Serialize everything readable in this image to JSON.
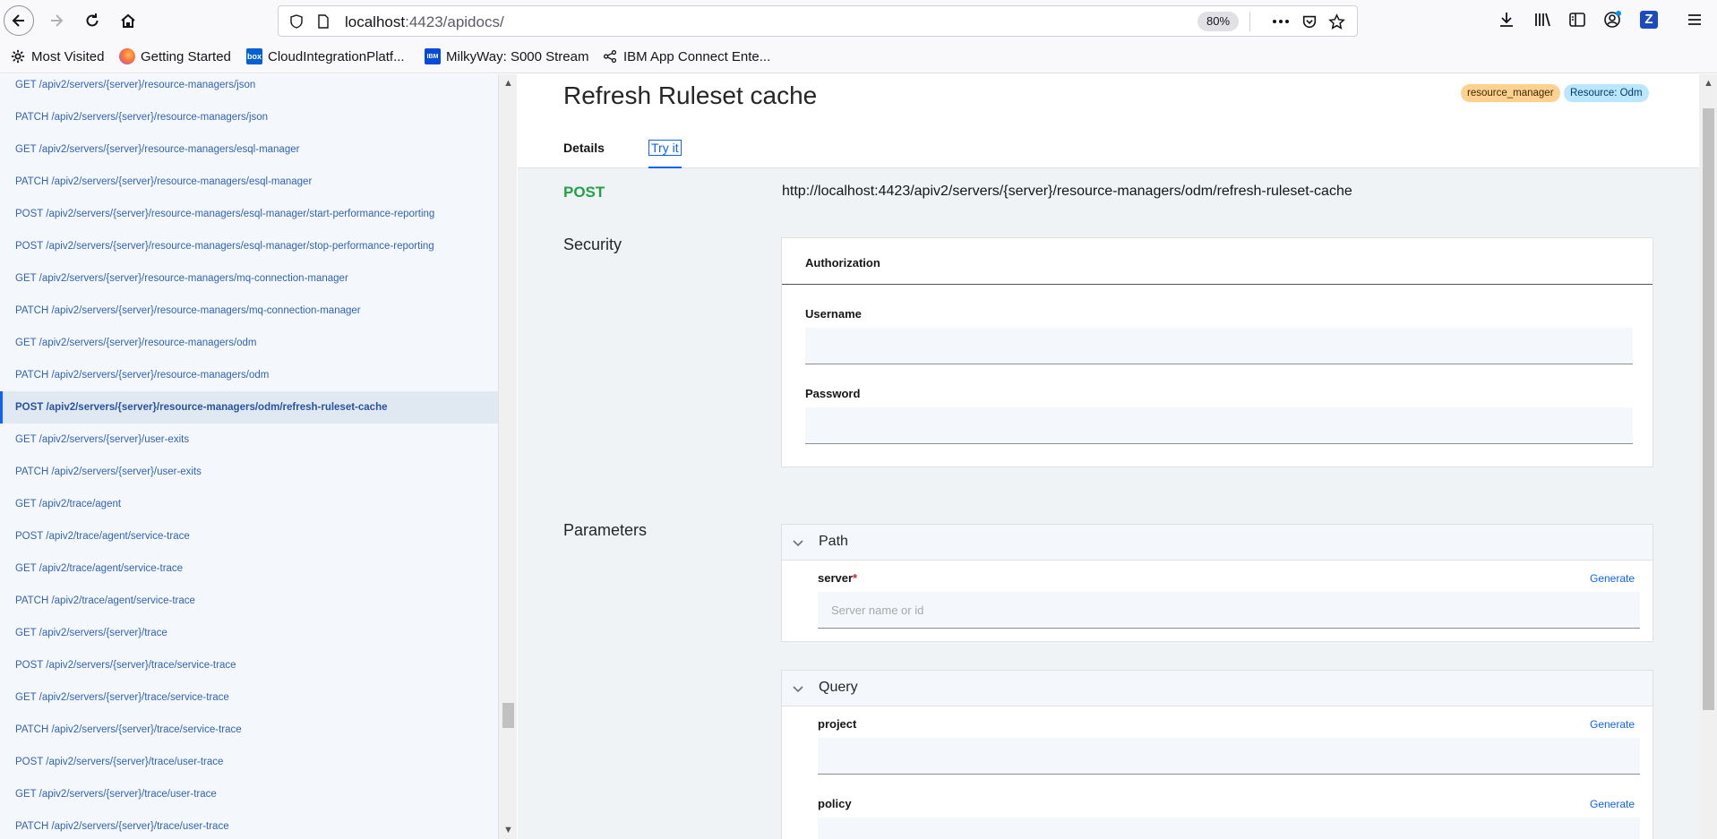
{
  "browser": {
    "url_host": "localhost",
    "url_rest": ":4423/apidocs/",
    "zoom": "80%"
  },
  "bookmarks": [
    {
      "label": "Most Visited",
      "icon": "gear-icon"
    },
    {
      "label": "Getting Started",
      "icon": "firefox-icon"
    },
    {
      "label": "CloudIntegrationPlatf...",
      "icon": "box-icon"
    },
    {
      "label": "MilkyWay: S000 Stream",
      "icon": "ibm-icon"
    },
    {
      "label": "IBM App Connect Ente...",
      "icon": "network-icon"
    }
  ],
  "sidebar": {
    "items": [
      {
        "label": "GET /apiv2/servers/{server}/resource-managers/json",
        "active": false
      },
      {
        "label": "PATCH /apiv2/servers/{server}/resource-managers/json",
        "active": false
      },
      {
        "label": "GET /apiv2/servers/{server}/resource-managers/esql-manager",
        "active": false
      },
      {
        "label": "PATCH /apiv2/servers/{server}/resource-managers/esql-manager",
        "active": false
      },
      {
        "label": "POST /apiv2/servers/{server}/resource-managers/esql-manager/start-performance-reporting",
        "active": false
      },
      {
        "label": "POST /apiv2/servers/{server}/resource-managers/esql-manager/stop-performance-reporting",
        "active": false
      },
      {
        "label": "GET /apiv2/servers/{server}/resource-managers/mq-connection-manager",
        "active": false
      },
      {
        "label": "PATCH /apiv2/servers/{server}/resource-managers/mq-connection-manager",
        "active": false
      },
      {
        "label": "GET /apiv2/servers/{server}/resource-managers/odm",
        "active": false
      },
      {
        "label": "PATCH /apiv2/servers/{server}/resource-managers/odm",
        "active": false
      },
      {
        "label": "POST /apiv2/servers/{server}/resource-managers/odm/refresh-ruleset-cache",
        "active": true
      },
      {
        "label": "GET /apiv2/servers/{server}/user-exits",
        "active": false
      },
      {
        "label": "PATCH /apiv2/servers/{server}/user-exits",
        "active": false
      },
      {
        "label": "GET /apiv2/trace/agent",
        "active": false
      },
      {
        "label": "POST /apiv2/trace/agent/service-trace",
        "active": false
      },
      {
        "label": "GET /apiv2/trace/agent/service-trace",
        "active": false
      },
      {
        "label": "PATCH /apiv2/trace/agent/service-trace",
        "active": false
      },
      {
        "label": "GET /apiv2/servers/{server}/trace",
        "active": false
      },
      {
        "label": "POST /apiv2/servers/{server}/trace/service-trace",
        "active": false
      },
      {
        "label": "GET /apiv2/servers/{server}/trace/service-trace",
        "active": false
      },
      {
        "label": "PATCH /apiv2/servers/{server}/trace/service-trace",
        "active": false
      },
      {
        "label": "POST /apiv2/servers/{server}/trace/user-trace",
        "active": false
      },
      {
        "label": "GET /apiv2/servers/{server}/trace/user-trace",
        "active": false
      },
      {
        "label": "PATCH /apiv2/servers/{server}/trace/user-trace",
        "active": false
      }
    ]
  },
  "main": {
    "title": "Refresh Ruleset cache",
    "tags": [
      "resource_manager",
      "Resource: Odm"
    ],
    "tabs": {
      "details": "Details",
      "try_it": "Try it"
    },
    "method": "POST",
    "endpoint": "http://localhost:4423/apiv2/servers/{server}/resource-managers/odm/refresh-ruleset-cache",
    "security": {
      "label": "Security",
      "card_title": "Authorization",
      "username_label": "Username",
      "username_value": "",
      "password_label": "Password",
      "password_value": ""
    },
    "parameters": {
      "label": "Parameters",
      "path": {
        "title": "Path",
        "server_label": "server",
        "required_mark": "*",
        "server_placeholder": "Server name or id",
        "generate": "Generate"
      },
      "query": {
        "title": "Query",
        "project_label": "project",
        "project_value": "",
        "policy_label": "policy",
        "generate": "Generate"
      }
    }
  }
}
